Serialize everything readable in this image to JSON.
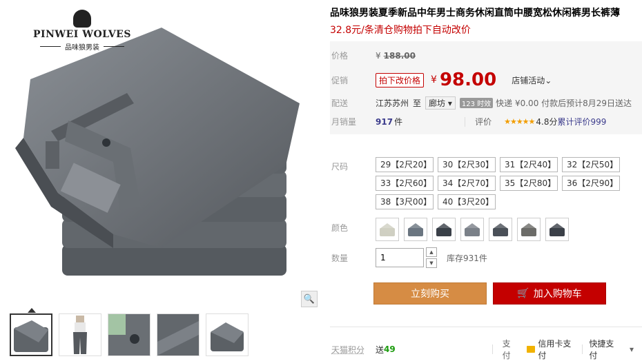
{
  "brand": {
    "name": "PINWEI WOLVES",
    "sub": "品味狼男装"
  },
  "product": {
    "title": "品味狼男装夏季新品中年男士商务休闲直筒中腰宽松休闲裤男长裤薄",
    "subtitle": "32.8元/条清仓购物拍下自动改价"
  },
  "price": {
    "label": "价格",
    "yen": "¥",
    "original": "188.00"
  },
  "promo": {
    "label": "促销",
    "tag": "拍下改价格",
    "yen": "¥",
    "price": "98.00",
    "shop_activity": "店铺活动",
    "chevron": "⌄"
  },
  "delivery": {
    "label": "配送",
    "from": "江苏苏州",
    "to_word": "至",
    "to_city": "廊坊",
    "chip": "123 时效",
    "method": "快递 ¥0.00 付款后预计8月29日送达"
  },
  "sales": {
    "label": "月销量",
    "count": "917",
    "unit": "件",
    "review_label": "评价",
    "stars": "★★★★★",
    "score": "4.8分",
    "review_text": "累计评价999"
  },
  "size": {
    "label": "尺码",
    "options": [
      "29【2尺20】",
      "30【2尺30】",
      "31【2尺40】",
      "32【2尺50】",
      "33【2尺60】",
      "34【2尺70】",
      "35【2尺80】",
      "36【2尺90】",
      "38【3尺00】",
      "40【3尺20】"
    ]
  },
  "color": {
    "label": "颜色",
    "swatches": [
      "#cfcfc2",
      "#6a7580",
      "#3a4048",
      "#7a8088",
      "#4a5058",
      "#6c6c68",
      "#3b4048"
    ]
  },
  "quantity": {
    "label": "数量",
    "value": "1",
    "up": "▲",
    "down": "▼",
    "stock": "库存931件"
  },
  "buttons": {
    "buy": "立刻购买",
    "cart": "加入购物车",
    "cart_icon": "🛒"
  },
  "footer": {
    "points_label": "天猫积分",
    "points_prefix": "送",
    "points": "49",
    "pay_label": "支付",
    "card": "信用卡支付",
    "quick": "快捷支付",
    "caret": "▾"
  },
  "colors": {
    "accent": "#c40000",
    "buy": "#d68c44"
  },
  "icons": {
    "zoom": "zoom-icon"
  }
}
